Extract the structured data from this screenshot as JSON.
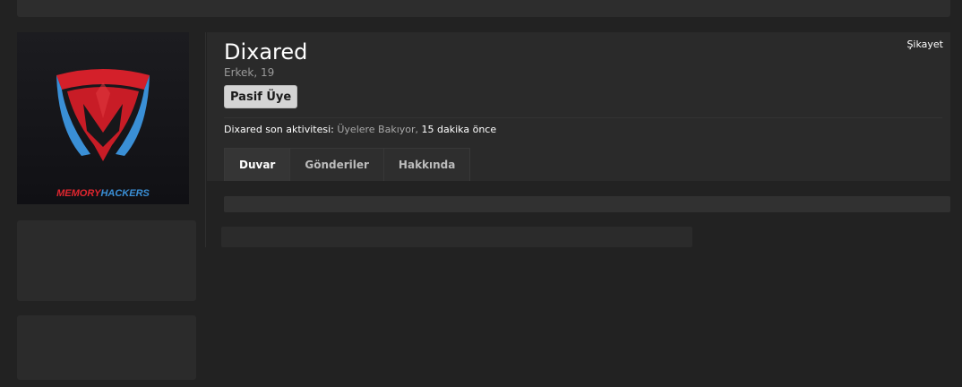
{
  "profile": {
    "username": "Dixared",
    "info": "Erkek, 19",
    "badge": "Pasif Üye",
    "report_label": "Şikayet"
  },
  "activity": {
    "prefix": "Dixared son aktivitesi:",
    "place": "Üyelere Bakıyor,",
    "time": "15 dakika önce"
  },
  "tabs": [
    {
      "label": "Duvar"
    },
    {
      "label": "Gönderiler"
    },
    {
      "label": "Hakkında"
    }
  ],
  "avatar": {
    "logo_word_1": "MEMORY",
    "logo_word_2": "HACKERS",
    "colors": {
      "red": "#d4202a",
      "blue": "#3a8fd6",
      "bg": "#17171a"
    }
  }
}
